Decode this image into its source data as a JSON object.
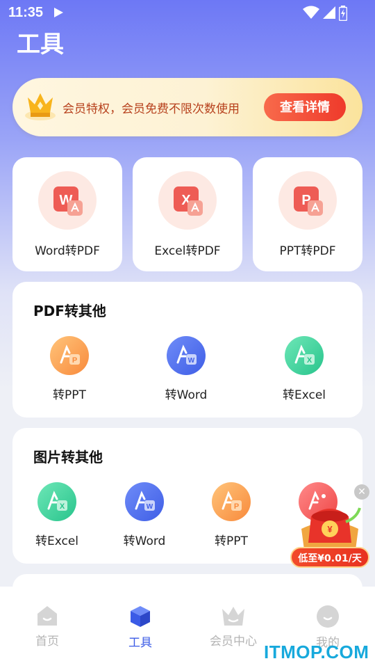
{
  "status_bar": {
    "time": "11:35"
  },
  "page": {
    "title": "工具"
  },
  "vip_banner": {
    "text": "会员特权，会员免费不限次数使用",
    "button": "查看详情"
  },
  "convert_cards": [
    {
      "label": "Word转PDF",
      "letter": "W"
    },
    {
      "label": "Excel转PDF",
      "letter": "X"
    },
    {
      "label": "PPT转PDF",
      "letter": "P"
    }
  ],
  "pdf_section": {
    "title": "PDF转其他",
    "items": [
      {
        "label": "转PPT",
        "letter": "P"
      },
      {
        "label": "转Word",
        "letter": "W"
      },
      {
        "label": "转Excel",
        "letter": "X"
      }
    ]
  },
  "image_section": {
    "title": "图片转其他",
    "items": [
      {
        "label": "转Excel",
        "letter": "X"
      },
      {
        "label": "转Word",
        "letter": "W"
      },
      {
        "label": "转PPT",
        "letter": "P"
      }
    ]
  },
  "promo": {
    "close": "✕",
    "label": "低至¥0.01/天"
  },
  "tab_bar": {
    "items": [
      {
        "label": "首页",
        "icon": "home-icon"
      },
      {
        "label": "工具",
        "icon": "cube-icon",
        "active": true
      },
      {
        "label": "会员中心",
        "icon": "crown-icon"
      },
      {
        "label": "我的",
        "icon": "smile-icon"
      }
    ]
  },
  "watermark": "ITMOP.COM",
  "colors": {
    "accent": "#3b5be6",
    "vip_button": "#ef3a2b",
    "header": "#6d78f5"
  }
}
